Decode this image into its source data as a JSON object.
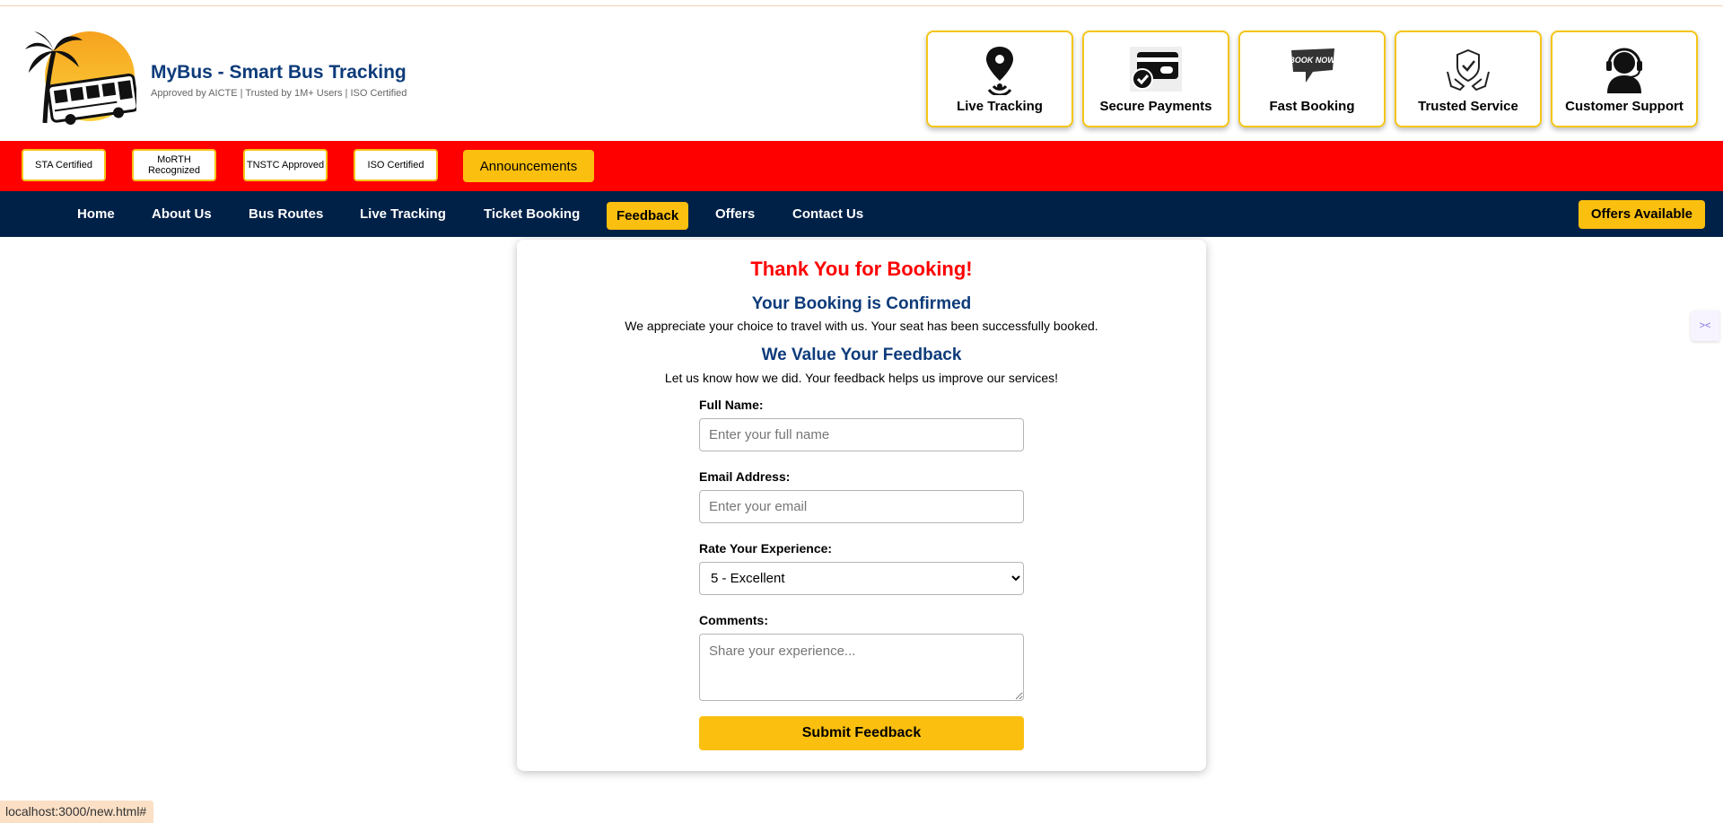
{
  "brand": {
    "title": "MyBus - Smart Bus Tracking",
    "subtitle": "Approved by AICTE | Trusted by 1M+ Users | ISO Certified"
  },
  "features": [
    {
      "label": "Live Tracking",
      "icon": "location-pin-icon"
    },
    {
      "label": "Secure Payments",
      "icon": "credit-card-icon"
    },
    {
      "label": "Fast Booking",
      "icon": "book-now-icon",
      "badge": "BOOK NOW"
    },
    {
      "label": "Trusted Service",
      "icon": "shield-hands-icon"
    },
    {
      "label": "Customer Support",
      "icon": "headset-icon"
    }
  ],
  "certifications": [
    "STA Certified",
    "MoRTH Recognized",
    "TNSTC Approved",
    "ISO Certified"
  ],
  "announcements_label": "Announcements",
  "nav": {
    "items": [
      "Home",
      "About Us",
      "Bus Routes",
      "Live Tracking",
      "Ticket Booking",
      "Feedback",
      "Offers",
      "Contact Us"
    ],
    "active": "Feedback",
    "offers_button": "Offers Available"
  },
  "confirmation": {
    "title": "Thank You for Booking!",
    "heading": "Your Booking is Confirmed",
    "message": "We appreciate your choice to travel with us. Your seat has been successfully booked."
  },
  "feedback": {
    "heading": "We Value Your Feedback",
    "intro": "Let us know how we did. Your feedback helps us improve our services!",
    "name_label": "Full Name:",
    "name_placeholder": "Enter your full name",
    "email_label": "Email Address:",
    "email_placeholder": "Enter your email",
    "rating_label": "Rate Your Experience:",
    "rating_selected": "5 - Excellent",
    "comments_label": "Comments:",
    "comments_placeholder": "Share your experience...",
    "submit_label": "Submit Feedback"
  },
  "status_url": "localhost:3000/new.html#",
  "colors": {
    "accent": "#fbbf0f",
    "red": "#ff0000",
    "navy": "#002147",
    "heading": "#0d3b7a"
  }
}
